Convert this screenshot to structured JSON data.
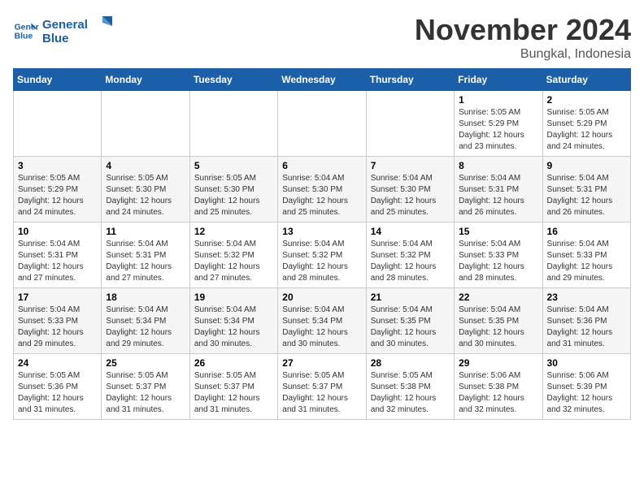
{
  "logo": {
    "line1": "General",
    "line2": "Blue"
  },
  "title": "November 2024",
  "location": "Bungkal, Indonesia",
  "days_of_week": [
    "Sunday",
    "Monday",
    "Tuesday",
    "Wednesday",
    "Thursday",
    "Friday",
    "Saturday"
  ],
  "weeks": [
    [
      {
        "day": "",
        "info": ""
      },
      {
        "day": "",
        "info": ""
      },
      {
        "day": "",
        "info": ""
      },
      {
        "day": "",
        "info": ""
      },
      {
        "day": "",
        "info": ""
      },
      {
        "day": "1",
        "info": "Sunrise: 5:05 AM\nSunset: 5:29 PM\nDaylight: 12 hours and 23 minutes."
      },
      {
        "day": "2",
        "info": "Sunrise: 5:05 AM\nSunset: 5:29 PM\nDaylight: 12 hours and 24 minutes."
      }
    ],
    [
      {
        "day": "3",
        "info": "Sunrise: 5:05 AM\nSunset: 5:29 PM\nDaylight: 12 hours and 24 minutes."
      },
      {
        "day": "4",
        "info": "Sunrise: 5:05 AM\nSunset: 5:30 PM\nDaylight: 12 hours and 24 minutes."
      },
      {
        "day": "5",
        "info": "Sunrise: 5:05 AM\nSunset: 5:30 PM\nDaylight: 12 hours and 25 minutes."
      },
      {
        "day": "6",
        "info": "Sunrise: 5:04 AM\nSunset: 5:30 PM\nDaylight: 12 hours and 25 minutes."
      },
      {
        "day": "7",
        "info": "Sunrise: 5:04 AM\nSunset: 5:30 PM\nDaylight: 12 hours and 25 minutes."
      },
      {
        "day": "8",
        "info": "Sunrise: 5:04 AM\nSunset: 5:31 PM\nDaylight: 12 hours and 26 minutes."
      },
      {
        "day": "9",
        "info": "Sunrise: 5:04 AM\nSunset: 5:31 PM\nDaylight: 12 hours and 26 minutes."
      }
    ],
    [
      {
        "day": "10",
        "info": "Sunrise: 5:04 AM\nSunset: 5:31 PM\nDaylight: 12 hours and 27 minutes."
      },
      {
        "day": "11",
        "info": "Sunrise: 5:04 AM\nSunset: 5:31 PM\nDaylight: 12 hours and 27 minutes."
      },
      {
        "day": "12",
        "info": "Sunrise: 5:04 AM\nSunset: 5:32 PM\nDaylight: 12 hours and 27 minutes."
      },
      {
        "day": "13",
        "info": "Sunrise: 5:04 AM\nSunset: 5:32 PM\nDaylight: 12 hours and 28 minutes."
      },
      {
        "day": "14",
        "info": "Sunrise: 5:04 AM\nSunset: 5:32 PM\nDaylight: 12 hours and 28 minutes."
      },
      {
        "day": "15",
        "info": "Sunrise: 5:04 AM\nSunset: 5:33 PM\nDaylight: 12 hours and 28 minutes."
      },
      {
        "day": "16",
        "info": "Sunrise: 5:04 AM\nSunset: 5:33 PM\nDaylight: 12 hours and 29 minutes."
      }
    ],
    [
      {
        "day": "17",
        "info": "Sunrise: 5:04 AM\nSunset: 5:33 PM\nDaylight: 12 hours and 29 minutes."
      },
      {
        "day": "18",
        "info": "Sunrise: 5:04 AM\nSunset: 5:34 PM\nDaylight: 12 hours and 29 minutes."
      },
      {
        "day": "19",
        "info": "Sunrise: 5:04 AM\nSunset: 5:34 PM\nDaylight: 12 hours and 30 minutes."
      },
      {
        "day": "20",
        "info": "Sunrise: 5:04 AM\nSunset: 5:34 PM\nDaylight: 12 hours and 30 minutes."
      },
      {
        "day": "21",
        "info": "Sunrise: 5:04 AM\nSunset: 5:35 PM\nDaylight: 12 hours and 30 minutes."
      },
      {
        "day": "22",
        "info": "Sunrise: 5:04 AM\nSunset: 5:35 PM\nDaylight: 12 hours and 30 minutes."
      },
      {
        "day": "23",
        "info": "Sunrise: 5:04 AM\nSunset: 5:36 PM\nDaylight: 12 hours and 31 minutes."
      }
    ],
    [
      {
        "day": "24",
        "info": "Sunrise: 5:05 AM\nSunset: 5:36 PM\nDaylight: 12 hours and 31 minutes."
      },
      {
        "day": "25",
        "info": "Sunrise: 5:05 AM\nSunset: 5:37 PM\nDaylight: 12 hours and 31 minutes."
      },
      {
        "day": "26",
        "info": "Sunrise: 5:05 AM\nSunset: 5:37 PM\nDaylight: 12 hours and 31 minutes."
      },
      {
        "day": "27",
        "info": "Sunrise: 5:05 AM\nSunset: 5:37 PM\nDaylight: 12 hours and 31 minutes."
      },
      {
        "day": "28",
        "info": "Sunrise: 5:05 AM\nSunset: 5:38 PM\nDaylight: 12 hours and 32 minutes."
      },
      {
        "day": "29",
        "info": "Sunrise: 5:06 AM\nSunset: 5:38 PM\nDaylight: 12 hours and 32 minutes."
      },
      {
        "day": "30",
        "info": "Sunrise: 5:06 AM\nSunset: 5:39 PM\nDaylight: 12 hours and 32 minutes."
      }
    ]
  ]
}
